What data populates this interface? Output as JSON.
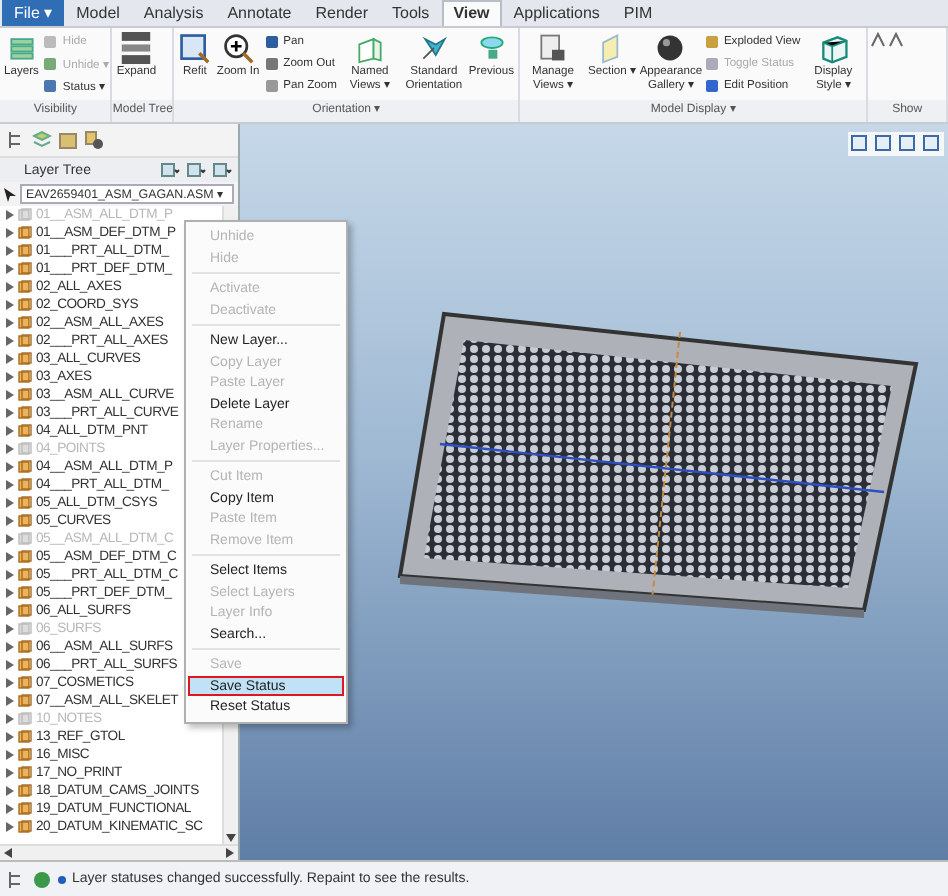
{
  "tabs": [
    {
      "label": "File ▾",
      "selected": false
    },
    {
      "label": "Model",
      "selected": false
    },
    {
      "label": "Analysis",
      "selected": false
    },
    {
      "label": "Annotate",
      "selected": false
    },
    {
      "label": "Render",
      "selected": false
    },
    {
      "label": "Tools",
      "selected": false
    },
    {
      "label": "View",
      "selected": true
    },
    {
      "label": "Applications",
      "selected": false
    },
    {
      "label": "PIM",
      "selected": false
    }
  ],
  "ribbon": [
    {
      "label": "Visibility",
      "buttons": [
        {
          "kind": "large",
          "label": "Layers",
          "disabled": false
        },
        {
          "kind": "small",
          "label": "Hide",
          "disabled": true
        },
        {
          "kind": "small",
          "label": "Unhide ▾",
          "disabled": true
        },
        {
          "kind": "small",
          "label": "Status ▾",
          "disabled": false
        }
      ]
    },
    {
      "label": "Model Tree",
      "buttons": [
        {
          "kind": "large",
          "label": "Expand",
          "disabled": false
        }
      ]
    },
    {
      "label": "Orientation ▾",
      "buttons": [
        {
          "kind": "large",
          "label": "Refit",
          "disabled": false
        },
        {
          "kind": "large",
          "label": "Zoom In",
          "disabled": false
        },
        {
          "kind": "small",
          "label": "Pan",
          "disabled": false
        },
        {
          "kind": "small",
          "label": "Zoom Out",
          "disabled": false
        },
        {
          "kind": "small",
          "label": "Pan Zoom",
          "disabled": false
        },
        {
          "kind": "large",
          "label": "Named Views ▾",
          "disabled": false
        },
        {
          "kind": "large",
          "label": "Standard Orientation",
          "disabled": false
        },
        {
          "kind": "large",
          "label": "Previous",
          "disabled": false
        }
      ]
    },
    {
      "label": "Model Display ▾",
      "buttons": [
        {
          "kind": "large",
          "label": "Manage Views ▾",
          "disabled": false
        },
        {
          "kind": "large",
          "label": "Section ▾",
          "disabled": false
        },
        {
          "kind": "large",
          "label": "Appearance Gallery ▾",
          "disabled": false
        },
        {
          "kind": "small",
          "label": "Exploded View",
          "disabled": false
        },
        {
          "kind": "small",
          "label": "Toggle Status",
          "disabled": true
        },
        {
          "kind": "small",
          "label": "Edit Position",
          "disabled": false
        },
        {
          "kind": "large",
          "label": "Display Style ▾",
          "disabled": false
        }
      ]
    },
    {
      "label": "Show"
    }
  ],
  "tree": {
    "title": "Layer Tree",
    "model": "EAV2659401_ASM_GAGAN.ASM ▾",
    "rows": [
      {
        "name": "01__ASM_ALL_DTM_P",
        "hidden": true
      },
      {
        "name": "01__ASM_DEF_DTM_P",
        "hidden": false
      },
      {
        "name": "01___PRT_ALL_DTM_",
        "hidden": false
      },
      {
        "name": "01___PRT_DEF_DTM_",
        "hidden": false
      },
      {
        "name": "02_ALL_AXES",
        "hidden": false
      },
      {
        "name": "02_COORD_SYS",
        "hidden": false
      },
      {
        "name": "02__ASM_ALL_AXES",
        "hidden": false
      },
      {
        "name": "02___PRT_ALL_AXES",
        "hidden": false
      },
      {
        "name": "03_ALL_CURVES",
        "hidden": false
      },
      {
        "name": "03_AXES",
        "hidden": false
      },
      {
        "name": "03__ASM_ALL_CURVE",
        "hidden": false
      },
      {
        "name": "03___PRT_ALL_CURVE",
        "hidden": false
      },
      {
        "name": "04_ALL_DTM_PNT",
        "hidden": false
      },
      {
        "name": "04_POINTS",
        "hidden": true
      },
      {
        "name": "04__ASM_ALL_DTM_P",
        "hidden": false
      },
      {
        "name": "04___PRT_ALL_DTM_",
        "hidden": false
      },
      {
        "name": "05_ALL_DTM_CSYS",
        "hidden": false
      },
      {
        "name": "05_CURVES",
        "hidden": false
      },
      {
        "name": "05__ASM_ALL_DTM_C",
        "hidden": true
      },
      {
        "name": "05__ASM_DEF_DTM_C",
        "hidden": false
      },
      {
        "name": "05___PRT_ALL_DTM_C",
        "hidden": false
      },
      {
        "name": "05___PRT_DEF_DTM_",
        "hidden": false
      },
      {
        "name": "06_ALL_SURFS",
        "hidden": false
      },
      {
        "name": "06_SURFS",
        "hidden": true
      },
      {
        "name": "06__ASM_ALL_SURFS",
        "hidden": false
      },
      {
        "name": "06___PRT_ALL_SURFS",
        "hidden": false
      },
      {
        "name": "07_COSMETICS",
        "hidden": false
      },
      {
        "name": "07__ASM_ALL_SKELET",
        "hidden": false
      },
      {
        "name": "10_NOTES",
        "hidden": true
      },
      {
        "name": "13_REF_GTOL",
        "hidden": false
      },
      {
        "name": "16_MISC",
        "hidden": false
      },
      {
        "name": "17_NO_PRINT",
        "hidden": false
      },
      {
        "name": "18_DATUM_CAMS_JOINTS",
        "hidden": false
      },
      {
        "name": "19_DATUM_FUNCTIONAL",
        "hidden": false
      },
      {
        "name": "20_DATUM_KINEMATIC_SC",
        "hidden": false
      }
    ]
  },
  "context_menu": [
    [
      {
        "label": "Unhide",
        "disabled": true,
        "selected": false
      },
      {
        "label": "Hide",
        "disabled": true,
        "selected": false
      }
    ],
    [
      {
        "label": "Activate",
        "disabled": true,
        "selected": false
      },
      {
        "label": "Deactivate",
        "disabled": true,
        "selected": false
      }
    ],
    [
      {
        "label": "New Layer...",
        "disabled": false,
        "selected": false
      },
      {
        "label": "Copy Layer",
        "disabled": true,
        "selected": false
      },
      {
        "label": "Paste Layer",
        "disabled": true,
        "selected": false
      },
      {
        "label": "Delete Layer",
        "disabled": false,
        "selected": false
      },
      {
        "label": "Rename",
        "disabled": true,
        "selected": false
      },
      {
        "label": "Layer Properties...",
        "disabled": true,
        "selected": false
      }
    ],
    [
      {
        "label": "Cut Item",
        "disabled": true,
        "selected": false
      },
      {
        "label": "Copy Item",
        "disabled": false,
        "selected": false
      },
      {
        "label": "Paste Item",
        "disabled": true,
        "selected": false
      },
      {
        "label": "Remove Item",
        "disabled": true,
        "selected": false
      }
    ],
    [
      {
        "label": "Select Items",
        "disabled": false,
        "selected": false
      },
      {
        "label": "Select Layers",
        "disabled": true,
        "selected": false
      },
      {
        "label": "Layer Info",
        "disabled": true,
        "selected": false
      },
      {
        "label": "Search...",
        "disabled": false,
        "selected": false
      }
    ],
    [
      {
        "label": "Save",
        "disabled": true,
        "selected": false
      },
      {
        "label": "Save Status",
        "disabled": false,
        "selected": true
      },
      {
        "label": "Reset Status",
        "disabled": false,
        "selected": false
      }
    ]
  ],
  "status_bar": {
    "message": "Layer statuses changed successfully. Repaint to see the results."
  }
}
